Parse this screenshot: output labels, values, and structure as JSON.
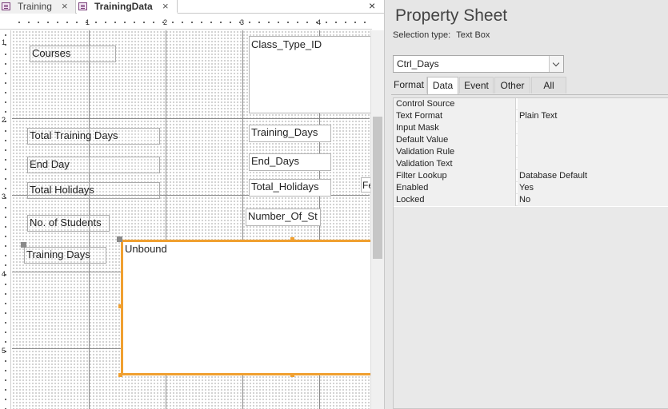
{
  "doc_tabs": [
    {
      "label": "Training"
    },
    {
      "label": "TrainingData"
    }
  ],
  "pane_close_glyph": "×",
  "tab_close_glyph": "×",
  "ruler": {
    "horizontal": [
      "1",
      "2",
      "3",
      "4"
    ],
    "vertical": [
      "1",
      "2",
      "3",
      "4",
      "5"
    ]
  },
  "designer": {
    "labels": {
      "courses": "Courses",
      "total_training_days": "Total Training Days",
      "end_day": "End Day",
      "total_holidays": "Total Holidays",
      "no_of_students": "No. of Students",
      "training_days": "Training Days"
    },
    "fields": {
      "class_type_id": "Class_Type_ID",
      "training_days": "Training_Days",
      "end_days": "End_Days",
      "total_holidays": "Total_Holidays",
      "number_of_students": "Number_Of_St",
      "fe_fragment": "Fe",
      "unbound": "Unbound"
    }
  },
  "property_sheet": {
    "title": "Property Sheet",
    "selection_type_label": "Selection type:",
    "selection_type_value": "Text Box",
    "selected_control": "Ctrl_Days",
    "tabs": [
      "Format",
      "Data",
      "Event",
      "Other",
      "All"
    ],
    "active_tab": "Data",
    "rows": [
      {
        "name": "Control Source",
        "value": ""
      },
      {
        "name": "Text Format",
        "value": "Plain Text"
      },
      {
        "name": "Input Mask",
        "value": ""
      },
      {
        "name": "Default Value",
        "value": ""
      },
      {
        "name": "Validation Rule",
        "value": ""
      },
      {
        "name": "Validation Text",
        "value": ""
      },
      {
        "name": "Filter Lookup",
        "value": "Database Default"
      },
      {
        "name": "Enabled",
        "value": "Yes"
      },
      {
        "name": "Locked",
        "value": "No"
      }
    ]
  },
  "colors": {
    "selection_outline": "#f0a030",
    "property_panel_bg": "#e6e6e6"
  }
}
